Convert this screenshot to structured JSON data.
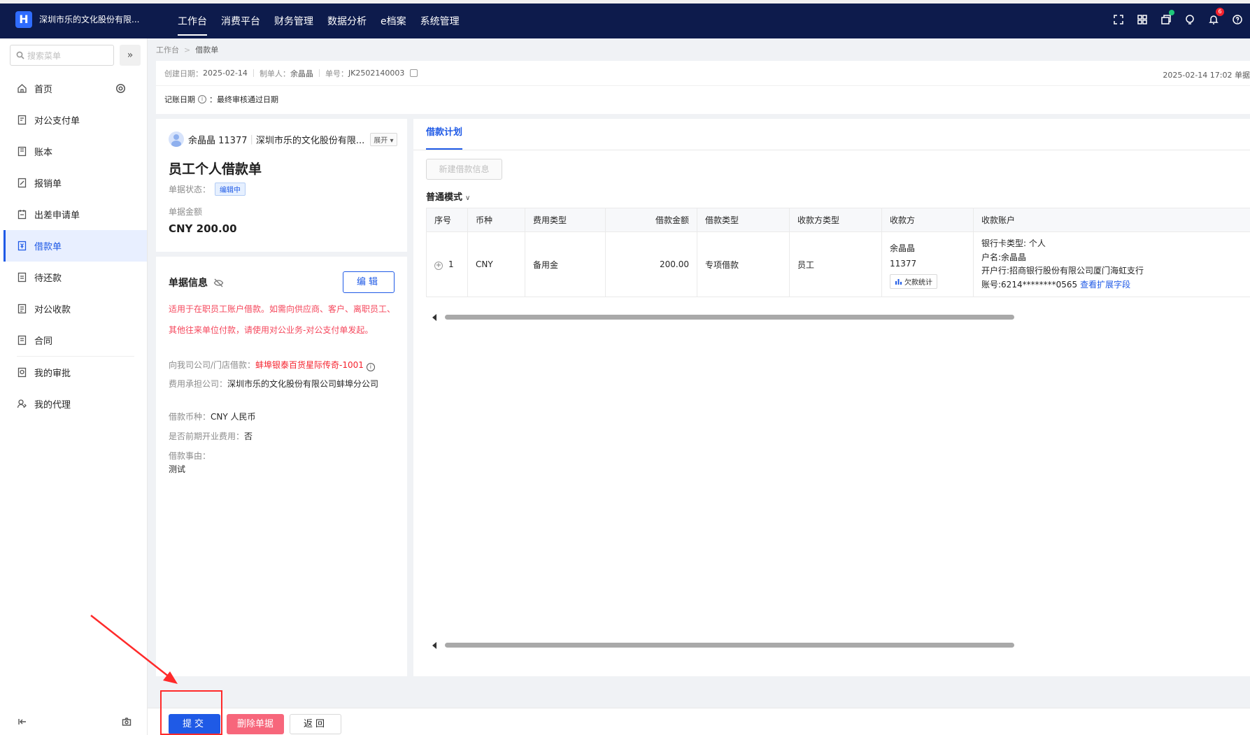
{
  "header": {
    "logo_glyph": "H",
    "company": "深圳市乐的文化股份有限...",
    "nav": [
      {
        "label": "工作台",
        "active": true
      },
      {
        "label": "消费平台"
      },
      {
        "label": "财务管理"
      },
      {
        "label": "数据分析"
      },
      {
        "label": "e档案"
      },
      {
        "label": "系统管理"
      }
    ],
    "icons": [
      "fullscreen-icon",
      "apps-icon",
      "tasks-icon",
      "location-icon",
      "bell-icon",
      "help-icon"
    ],
    "bell_badge": "6"
  },
  "sidebar": {
    "search_placeholder": "搜索菜单",
    "collapse_glyph": "»",
    "items": [
      {
        "label": "首页",
        "icon": "home-icon"
      },
      {
        "label": "对公支付单",
        "icon": "payment-doc-icon"
      },
      {
        "label": "账本",
        "icon": "ledger-icon"
      },
      {
        "label": "报销单",
        "icon": "reimburse-icon"
      },
      {
        "label": "出差申请单",
        "icon": "trip-icon"
      },
      {
        "label": "借款单",
        "icon": "loan-icon",
        "active": true
      },
      {
        "label": "待还款",
        "icon": "repay-icon"
      },
      {
        "label": "对公收款",
        "icon": "receipt-icon"
      },
      {
        "label": "合同",
        "icon": "contract-icon"
      },
      {
        "label": "我的审批",
        "icon": "approval-icon"
      },
      {
        "label": "我的代理",
        "icon": "agent-icon"
      }
    ]
  },
  "breadcrumb": {
    "root": "工作台",
    "sep": ">",
    "current": "借款单"
  },
  "meta": {
    "created_label": "创建日期：",
    "created_value": "2025-02-14",
    "maker_label": "制单人：",
    "maker_value": "余晶晶",
    "number_label": "单号：",
    "number_value": "JK2502140003",
    "right_text": "2025-02-14 17:02 单据",
    "account_date_label": "记账日期",
    "account_date_value": "：最终审核通过日期"
  },
  "summary": {
    "user": "余晶晶 11377",
    "company": "深圳市乐的文化股份有限...",
    "expand": "展开",
    "title": "员工个人借款单",
    "status_label": "单据状态：",
    "status_value": "编辑中",
    "amount_label": "单据金额",
    "amount_value": "CNY 200.00"
  },
  "info": {
    "title": "单据信息",
    "edit_button": "编辑",
    "warning": "适用于在职员工账户借款。如需向供应商、客户、离职员工、其他往来单位付款，请使用对公业务-对公支付单发起。",
    "fields": [
      {
        "label": "向我司公司/门店借款：",
        "value": "蚌埠银泰百货星际传奇-1001"
      },
      {
        "label": "费用承担公司：",
        "value": "深圳市乐的文化股份有限公司蚌埠分公司"
      },
      {
        "label": "借款币种：",
        "value": "CNY 人民币"
      },
      {
        "label": "是否前期开业费用：",
        "value": "否"
      },
      {
        "label": "借款事由：",
        "value": "测试"
      }
    ]
  },
  "plan": {
    "tab": "借款计划",
    "new_button": "新建借款信息",
    "mode": "普通模式",
    "columns": [
      "序号",
      "币种",
      "费用类型",
      "借款金额",
      "借款类型",
      "收款方类型",
      "收款方",
      "收款账户"
    ],
    "row": {
      "index": "1",
      "currency": "CNY",
      "expense_type": "备用金",
      "amount": "200.00",
      "loan_type": "专项借款",
      "payee_type": "员工",
      "payee_name": "余晶晶",
      "payee_id": "11377",
      "stat_button": "欠款统计",
      "account_lines": [
        "银行卡类型: 个人",
        "户名:余晶晶",
        "开户行:招商银行股份有限公司厦门海虹支行",
        "账号:6214********0565"
      ],
      "account_link": "查看扩展字段"
    }
  },
  "actions": {
    "submit": "提交",
    "delete": "删除单据",
    "back": "返回"
  },
  "colors": {
    "topbar": "#0d1b4c",
    "primary": "#1f5ae6",
    "danger": "#f7667b",
    "warning_text": "#f5475c",
    "annotation": "#ff2a2a"
  }
}
